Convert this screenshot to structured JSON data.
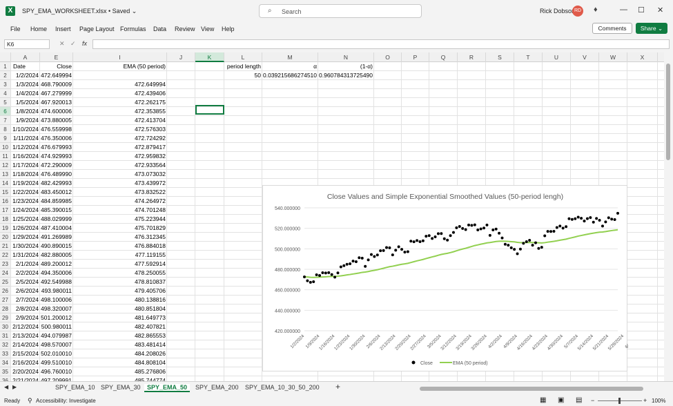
{
  "window": {
    "doc_title": "SPY_EMA_WORKSHEET.xlsx • Saved",
    "search_placeholder": "Search",
    "user_name": "Rick Dobson",
    "user_initials": "RD"
  },
  "menu": [
    "File",
    "Home",
    "Insert",
    "Page Layout",
    "Formulas",
    "Data",
    "Review",
    "View",
    "Help"
  ],
  "toolbar": {
    "comments_label": "Comments",
    "share_label": "Share"
  },
  "formula_bar": {
    "name_box": "K6",
    "formula": ""
  },
  "columns": [
    "A",
    "E",
    "I",
    "J",
    "K",
    "L",
    "M",
    "N",
    "O",
    "P",
    "Q",
    "R",
    "S",
    "T",
    "U",
    "V",
    "W",
    "X"
  ],
  "sheet": {
    "headers": {
      "date": "Date",
      "close": "Close",
      "ema": "EMA (50 period)"
    },
    "params": {
      "period_label": "period length",
      "alpha_label": "α",
      "one_minus_alpha_label": "(1-α)",
      "period_value": "50",
      "alpha_value": "0.039215686274510",
      "one_minus_alpha_value": "0.960784313725490"
    },
    "rows": [
      {
        "date": "1/2/2024",
        "close": "472.649994",
        "ema": ""
      },
      {
        "date": "1/3/2024",
        "close": "468.790009",
        "ema": "472.649994"
      },
      {
        "date": "1/4/2024",
        "close": "467.279999",
        "ema": "472.439406"
      },
      {
        "date": "1/5/2024",
        "close": "467.920013",
        "ema": "472.262175"
      },
      {
        "date": "1/8/2024",
        "close": "474.600006",
        "ema": "472.353855"
      },
      {
        "date": "1/9/2024",
        "close": "473.880005",
        "ema": "472.413704"
      },
      {
        "date": "1/10/2024",
        "close": "476.559998",
        "ema": "472.576303"
      },
      {
        "date": "1/11/2024",
        "close": "476.350006",
        "ema": "472.724292"
      },
      {
        "date": "1/12/2024",
        "close": "476.679993",
        "ema": "472.879417"
      },
      {
        "date": "1/16/2024",
        "close": "474.929993",
        "ema": "472.959832"
      },
      {
        "date": "1/17/2024",
        "close": "472.290009",
        "ema": "472.933564"
      },
      {
        "date": "1/18/2024",
        "close": "476.489990",
        "ema": "473.073032"
      },
      {
        "date": "1/19/2024",
        "close": "482.429993",
        "ema": "473.439972"
      },
      {
        "date": "1/22/2024",
        "close": "483.450012",
        "ema": "473.832522"
      },
      {
        "date": "1/23/2024",
        "close": "484.859985",
        "ema": "474.264972"
      },
      {
        "date": "1/24/2024",
        "close": "485.390015",
        "ema": "474.701248"
      },
      {
        "date": "1/25/2024",
        "close": "488.029999",
        "ema": "475.223944"
      },
      {
        "date": "1/26/2024",
        "close": "487.410004",
        "ema": "475.701829"
      },
      {
        "date": "1/29/2024",
        "close": "491.269989",
        "ema": "476.312345"
      },
      {
        "date": "1/30/2024",
        "close": "490.890015",
        "ema": "476.884018"
      },
      {
        "date": "1/31/2024",
        "close": "482.880005",
        "ema": "477.119155"
      },
      {
        "date": "2/1/2024",
        "close": "489.200012",
        "ema": "477.592914"
      },
      {
        "date": "2/2/2024",
        "close": "494.350006",
        "ema": "478.250055"
      },
      {
        "date": "2/5/2024",
        "close": "492.549988",
        "ema": "478.810837"
      },
      {
        "date": "2/6/2024",
        "close": "493.980011",
        "ema": "479.405706"
      },
      {
        "date": "2/7/2024",
        "close": "498.100006",
        "ema": "480.138816"
      },
      {
        "date": "2/8/2024",
        "close": "498.320007",
        "ema": "480.851804"
      },
      {
        "date": "2/9/2024",
        "close": "501.200012",
        "ema": "481.649773"
      },
      {
        "date": "2/12/2024",
        "close": "500.980011",
        "ema": "482.407821"
      },
      {
        "date": "2/13/2024",
        "close": "494.079987",
        "ema": "482.865553"
      },
      {
        "date": "2/14/2024",
        "close": "498.570007",
        "ema": "483.481414"
      },
      {
        "date": "2/15/2024",
        "close": "502.010010",
        "ema": "484.208026"
      },
      {
        "date": "2/16/2024",
        "close": "499.510010",
        "ema": "484.808104"
      },
      {
        "date": "2/20/2024",
        "close": "496.760010",
        "ema": "485.276806"
      },
      {
        "date": "2/21/2024",
        "close": "497.209991",
        "ema": "485.744774"
      }
    ]
  },
  "chart_data": {
    "type": "scatter",
    "title": "Close Values and Simple Exponential Smoothed Values (50-period lengh)",
    "xlabel": "",
    "ylabel": "",
    "ylim": [
      420,
      540
    ],
    "yticks": [
      "420.000000",
      "440.000000",
      "460.000000",
      "480.000000",
      "500.000000",
      "520.000000",
      "540.000000"
    ],
    "xticks": [
      "1/2/2024",
      "1/9/2024",
      "1/16/2024",
      "1/23/2024",
      "1/30/2024",
      "2/6/2024",
      "2/13/2024",
      "2/20/2024",
      "2/27/2024",
      "3/5/2024",
      "3/12/2024",
      "3/19/2024",
      "3/26/2024",
      "4/2/2024",
      "4/9/2024",
      "4/16/2024",
      "4/23/2024",
      "4/30/2024",
      "5/7/2024",
      "5/14/2024",
      "5/21/2024",
      "5/28/2024",
      "6/4/2024"
    ],
    "legend_position": "bottom",
    "grid": true,
    "series": [
      {
        "name": "Close",
        "color": "#000000",
        "marker": "dot",
        "values": [
          472.6,
          468.8,
          467.3,
          467.9,
          474.6,
          473.9,
          476.6,
          476.4,
          476.7,
          474.9,
          472.3,
          476.5,
          482.4,
          483.5,
          484.9,
          485.4,
          488.0,
          487.4,
          491.3,
          490.9,
          482.9,
          489.2,
          494.4,
          492.5,
          494.0,
          498.1,
          498.3,
          501.2,
          501.0,
          494.1,
          498.6,
          502.0,
          499.5,
          496.8,
          497.2,
          507.5,
          506.9,
          508.1,
          507.0,
          507.8,
          512.3,
          512.9,
          510.1,
          511.7,
          514.8,
          514.9,
          509.8,
          508.5,
          512.9,
          516.0,
          520.5,
          521.8,
          519.9,
          518.8,
          523.2,
          522.9,
          523.4,
          518.4,
          519.4,
          520.3,
          523.2,
          513.1,
          518.4,
          519.3,
          515.2,
          510.6,
          504.4,
          503.5,
          501.0,
          499.5,
          495.2,
          499.7,
          505.4,
          507.0,
          508.3,
          503.5,
          505.9,
          500.4,
          501.5,
          512.7,
          517.0,
          516.9,
          517.1,
          520.8,
          522.2,
          520.2,
          521.6,
          529.4,
          528.7,
          529.4,
          530.9,
          529.8,
          527.1,
          529.5,
          530.5,
          526.0,
          529.6,
          527.9,
          522.2,
          526.3,
          530.3,
          529.0,
          528.5,
          534.7
        ]
      },
      {
        "name": "EMA (50 period)",
        "color": "#92d050",
        "marker": "line",
        "values": [
          472.6,
          472.5,
          472.2,
          472.1,
          472.2,
          472.3,
          472.5,
          472.7,
          472.9,
          473.0,
          473.0,
          473.3,
          473.6,
          474.0,
          474.5,
          474.9,
          475.4,
          475.9,
          476.4,
          477.0,
          477.3,
          477.8,
          478.5,
          479.0,
          479.6,
          480.3,
          481.0,
          481.8,
          482.5,
          483.0,
          483.6,
          484.3,
          484.9,
          485.3,
          485.8,
          486.6,
          487.4,
          488.2,
          488.9,
          489.6,
          490.5,
          491.3,
          492.1,
          492.8,
          493.7,
          494.5,
          495.1,
          495.6,
          496.3,
          497.1,
          498.1,
          499.0,
          499.8,
          500.5,
          501.4,
          502.3,
          503.2,
          503.8,
          504.5,
          505.1,
          505.8,
          506.1,
          506.6,
          507.1,
          507.4,
          507.5,
          507.4,
          507.2,
          507.0,
          506.8,
          506.3,
          506.0,
          506.0,
          506.1,
          506.2,
          506.1,
          506.1,
          505.9,
          505.7,
          506.0,
          506.5,
          506.9,
          507.3,
          507.8,
          508.4,
          508.9,
          509.4,
          510.2,
          510.9,
          511.6,
          512.4,
          513.0,
          513.6,
          514.2,
          514.8,
          515.3,
          515.8,
          516.2,
          516.4,
          516.8,
          517.3,
          517.8,
          518.2,
          518.6
        ]
      }
    ]
  },
  "tabs": [
    "SPY_EMA_10",
    "SPY_EMA_30",
    "SPY_EMA_50",
    "SPY_EMA_200",
    "SPY_EMA_10_30_50_200",
    "+"
  ],
  "active_tab": "SPY_EMA_50",
  "status": {
    "ready": "Ready",
    "accessibility": "Accessibility: Investigate",
    "zoom": "100%"
  }
}
